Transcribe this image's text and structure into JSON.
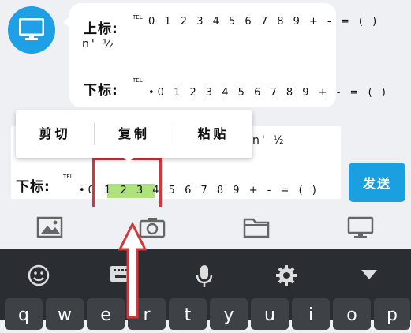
{
  "message": {
    "superscript_label": "上标:",
    "superscript_tel": "TEL",
    "superscript_digits": "0 1 2 3 4 5 6 7 8 9 + - = ( )",
    "superscript_extra": "n' ½",
    "subscript_label": "下标:",
    "subscript_tel": "TEL",
    "subscript_digits": "•0 1 2 3 4 5 6 7 8 9 + - = ( )"
  },
  "input": {
    "extra_text": "n' ½",
    "subscript_label": "下标:",
    "subscript_tel": "TEL",
    "subscript_digits": "•0 1 2 3 4 5 6 7 8 9 + - = ( )"
  },
  "context_menu": {
    "cut": "剪切",
    "copy": "复制",
    "paste": "粘贴"
  },
  "send_label": "发送",
  "toolbar_icons": [
    "image-icon",
    "camera-icon",
    "folder-icon",
    "monitor-icon"
  ],
  "keyboard_icons": [
    "emoji-icon",
    "keyboard-icon",
    "mic-icon",
    "settings-icon",
    "collapse-icon"
  ],
  "keys": [
    "q",
    "w",
    "e",
    "r",
    "t",
    "y",
    "u",
    "i",
    "o",
    "p"
  ],
  "colors": {
    "accent": "#1a9fe0",
    "selection": "#aee27a",
    "annotation_red": "#d9343a",
    "keyboard_bg": "#2a2d31"
  }
}
